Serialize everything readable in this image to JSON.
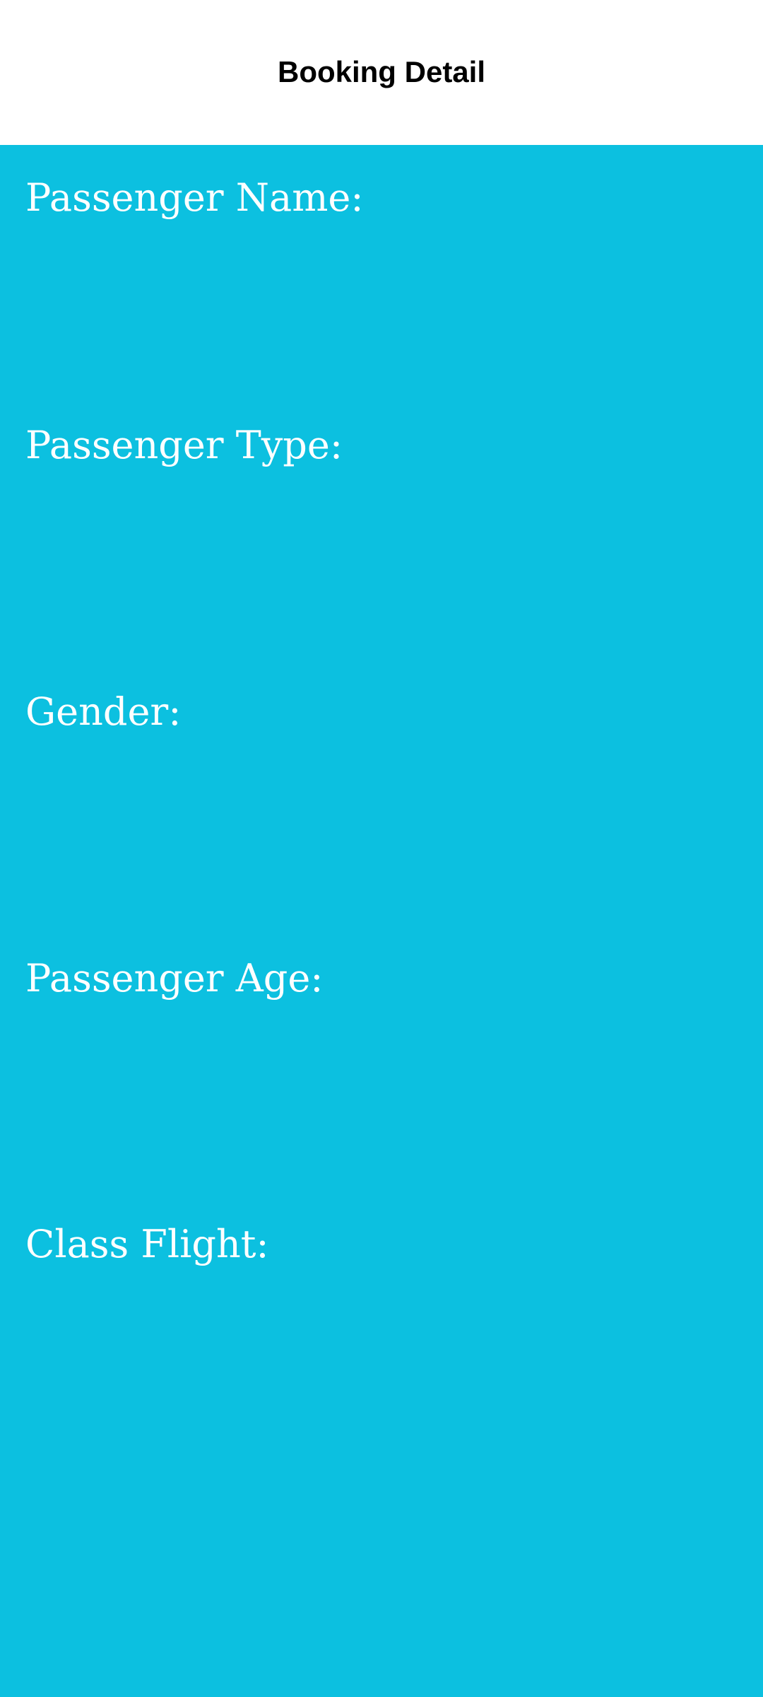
{
  "app_bar": {
    "title": "Booking Detail"
  },
  "fields": [
    {
      "label": "Passenger Name:",
      "value": ""
    },
    {
      "label": "Passenger Type:",
      "value": ""
    },
    {
      "label": "Gender:",
      "value": ""
    },
    {
      "label": "Passenger Age:",
      "value": ""
    },
    {
      "label": "Class Flight:",
      "value": ""
    }
  ],
  "colors": {
    "app_bar_background": "#FFFFFF",
    "content_background": "#0CC0E0",
    "label_text": "#FFFFFF",
    "title_text": "#000000"
  }
}
